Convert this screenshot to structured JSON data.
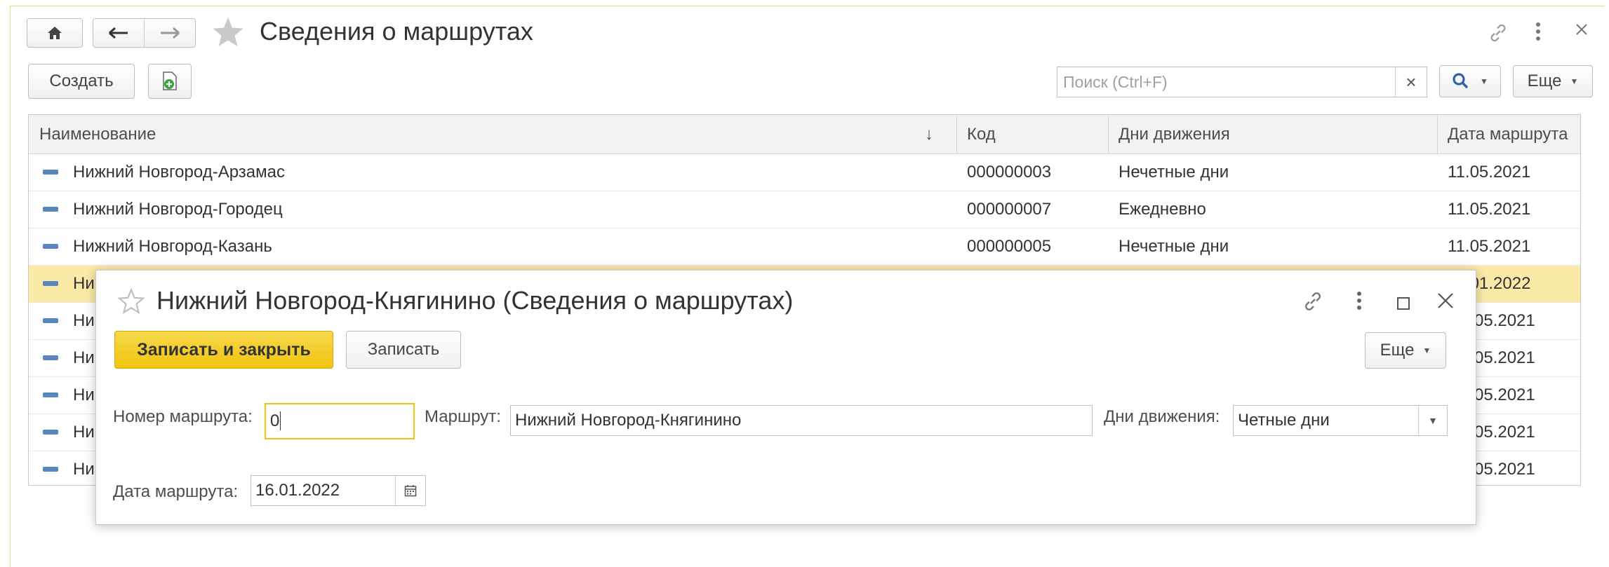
{
  "header": {
    "title": "Сведения о маршрутах",
    "home_icon": "home-icon",
    "back_icon": "arrow-left-icon",
    "forward_icon": "arrow-right-icon",
    "favorite_icon": "star-icon",
    "link_icon": "link-icon",
    "menu_icon": "more-vertical-icon",
    "close_icon": "close-icon"
  },
  "toolbar": {
    "create_label": "Создать",
    "search_placeholder": "Поиск (Ctrl+F)",
    "search_clear": "×",
    "more_label": "Еще",
    "search_button_icon": "search-icon"
  },
  "table": {
    "columns": [
      "Наименование",
      "Код",
      "Дни движения",
      "Дата маршрута"
    ],
    "sort_indicator": "↓",
    "rows": [
      {
        "name": "Нижний Новгород-Арзамас",
        "code": "000000003",
        "days": "Нечетные дни",
        "date": "11.05.2021"
      },
      {
        "name": "Нижний Новгород-Городец",
        "code": "000000007",
        "days": "Ежедневно",
        "date": "11.05.2021"
      },
      {
        "name": "Нижний Новгород-Казань",
        "code": "000000005",
        "days": "Нечетные дни",
        "date": "11.05.2021"
      },
      {
        "name": "Ни",
        "code": "",
        "days": "",
        "date": ".01.2022"
      },
      {
        "name": "Ни",
        "code": "",
        "days": "",
        "date": "05.2021"
      },
      {
        "name": "Ни",
        "code": "",
        "days": "",
        "date": "05.2021"
      },
      {
        "name": "Ни",
        "code": "",
        "days": "",
        "date": "05.2021"
      },
      {
        "name": "Ни",
        "code": "",
        "days": "",
        "date": "05.2021"
      },
      {
        "name": "Ни",
        "code": "",
        "days": "",
        "date": "05.2021"
      }
    ]
  },
  "modal": {
    "title": "Нижний Новгород-Княгинино (Сведения о маршрутах)",
    "save_close_label": "Записать и закрыть",
    "save_label": "Записать",
    "more_label": "Еще",
    "route_number_label": "Номер маршрута:",
    "route_number_value": "0",
    "route_label": "Маршрут:",
    "route_value": "Нижний Новгород-Княгинино",
    "days_label": "Дни движения:",
    "days_value": "Четные дни",
    "date_label": "Дата маршрута:",
    "date_value": "16.01.2022"
  },
  "colors": {
    "accent": "#f1c40f",
    "selected_row": "#fbeaa7",
    "row_marker": "#5a86c0"
  }
}
